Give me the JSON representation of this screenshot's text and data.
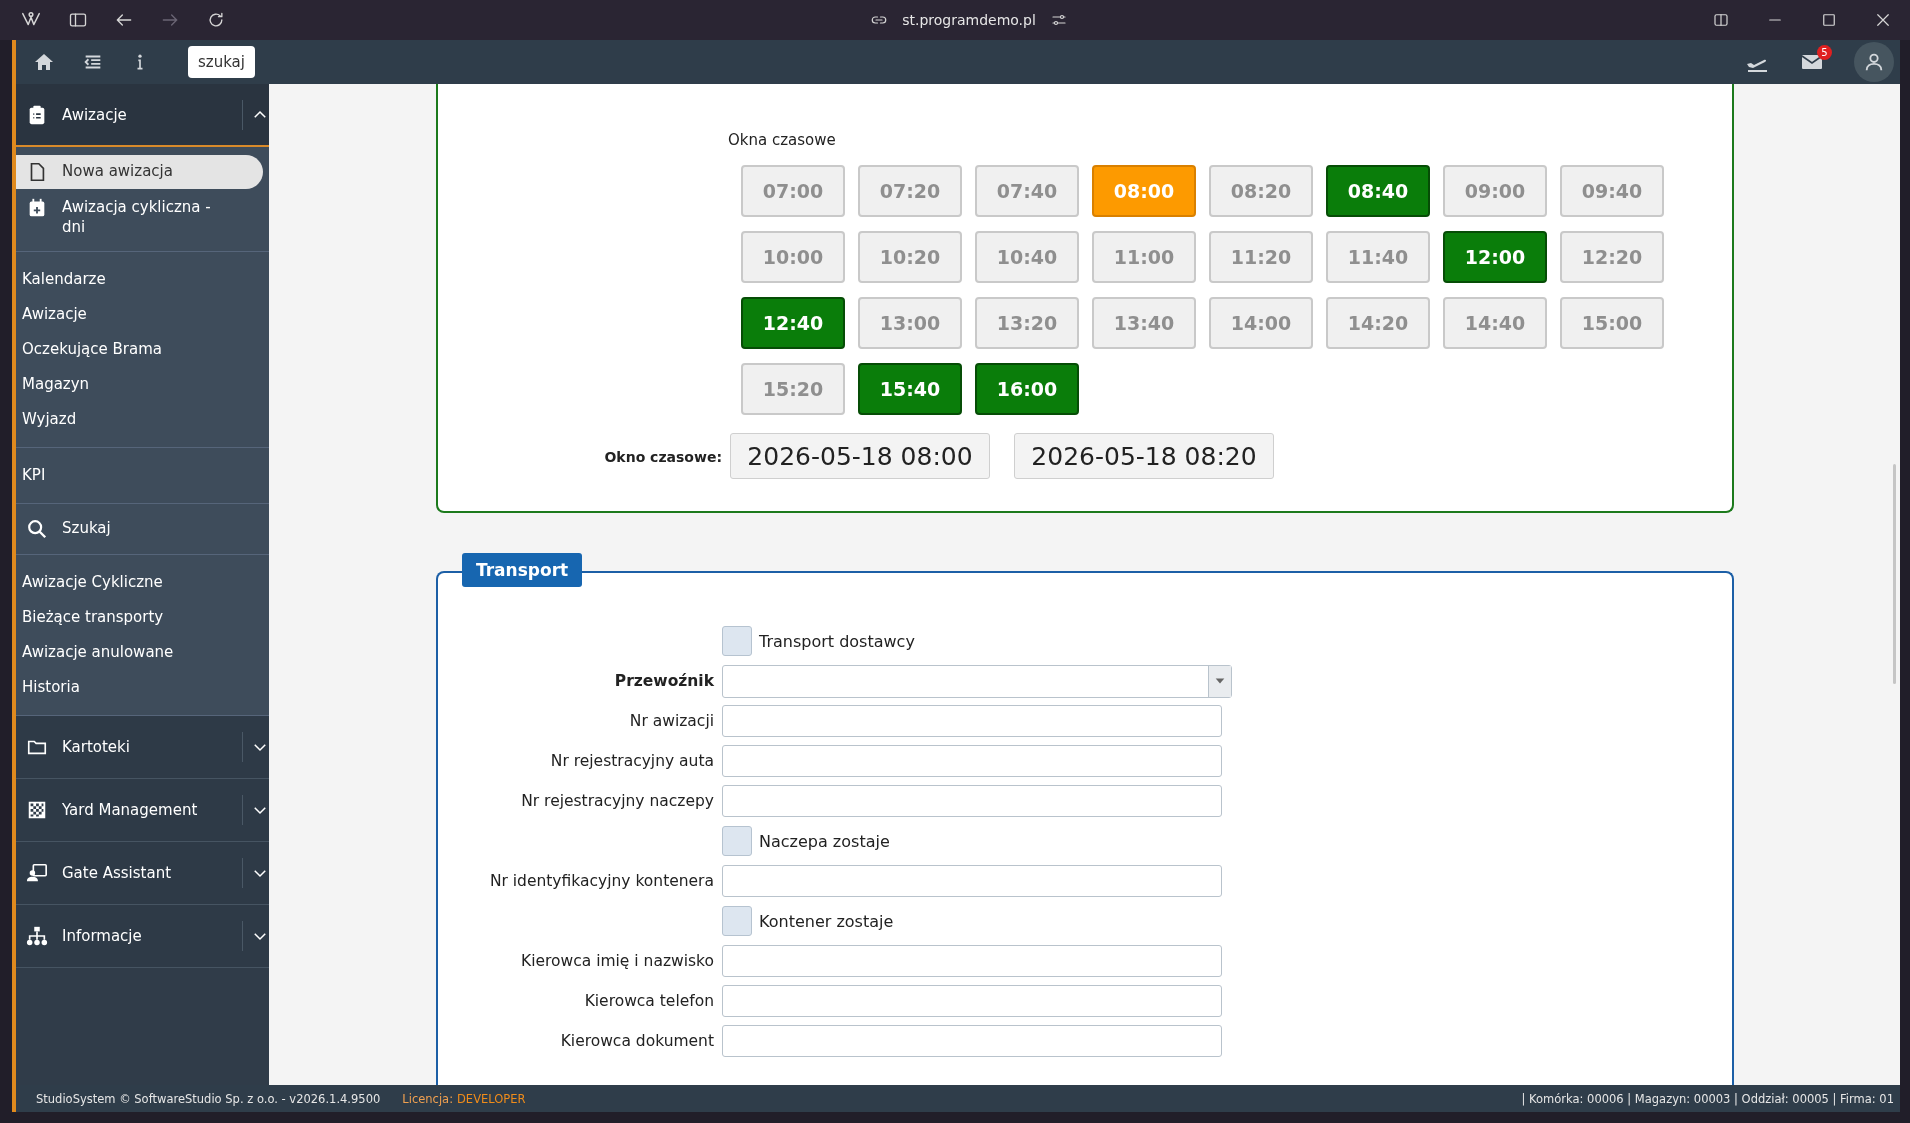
{
  "browser": {
    "url": "st.programdemo.pl",
    "forward_disabled": true
  },
  "toolbar": {
    "search_button": "szukaj",
    "mail_count": "5"
  },
  "sidebar": [
    {
      "kind": "header",
      "label": "Awizacje",
      "expanded": true
    },
    {
      "kind": "icon_links",
      "items": [
        {
          "label": "Nowa awizacja",
          "selected": true
        },
        {
          "label": "Awizacja cykliczna - dni",
          "selected": false
        }
      ]
    },
    {
      "kind": "links",
      "items": [
        "Kalendarze",
        "Awizacje",
        "Oczekujące Brama",
        "Magazyn",
        "Wyjazd"
      ]
    },
    {
      "kind": "links",
      "items": [
        "KPI"
      ]
    },
    {
      "kind": "icon_links",
      "items": [
        {
          "label": "Szukaj",
          "selected": false
        }
      ]
    },
    {
      "kind": "links",
      "items": [
        "Awizacje Cykliczne",
        "Bieżące transporty",
        "Awizacje anulowane",
        "Historia"
      ]
    },
    {
      "kind": "header",
      "label": "Kartoteki",
      "expanded": false
    },
    {
      "kind": "header",
      "label": "Yard Management",
      "expanded": false
    },
    {
      "kind": "header",
      "label": "Gate Assistant",
      "expanded": false
    },
    {
      "kind": "header",
      "label": "Informacje",
      "expanded": false
    }
  ],
  "time_windows": {
    "title": "Okna czasowe",
    "slots": [
      {
        "time": "07:00",
        "available": false,
        "selected": false
      },
      {
        "time": "07:20",
        "available": false,
        "selected": false
      },
      {
        "time": "07:40",
        "available": false,
        "selected": false
      },
      {
        "time": "08:00",
        "available": true,
        "selected": true
      },
      {
        "time": "08:20",
        "available": false,
        "selected": false
      },
      {
        "time": "08:40",
        "available": true,
        "selected": false
      },
      {
        "time": "09:00",
        "available": false,
        "selected": false
      },
      {
        "time": "09:40",
        "available": false,
        "selected": false
      },
      {
        "time": "10:00",
        "available": false,
        "selected": false
      },
      {
        "time": "10:20",
        "available": false,
        "selected": false
      },
      {
        "time": "10:40",
        "available": false,
        "selected": false
      },
      {
        "time": "11:00",
        "available": false,
        "selected": false
      },
      {
        "time": "11:20",
        "available": false,
        "selected": false
      },
      {
        "time": "11:40",
        "available": false,
        "selected": false
      },
      {
        "time": "12:00",
        "available": true,
        "selected": false
      },
      {
        "time": "12:20",
        "available": false,
        "selected": false
      },
      {
        "time": "12:40",
        "available": true,
        "selected": false
      },
      {
        "time": "13:00",
        "available": false,
        "selected": false
      },
      {
        "time": "13:20",
        "available": false,
        "selected": false
      },
      {
        "time": "13:40",
        "available": false,
        "selected": false
      },
      {
        "time": "14:00",
        "available": false,
        "selected": false
      },
      {
        "time": "14:20",
        "available": false,
        "selected": false
      },
      {
        "time": "14:40",
        "available": false,
        "selected": false
      },
      {
        "time": "15:00",
        "available": false,
        "selected": false
      },
      {
        "time": "15:20",
        "available": false,
        "selected": false
      },
      {
        "time": "15:40",
        "available": true,
        "selected": false
      },
      {
        "time": "16:00",
        "available": true,
        "selected": false
      }
    ],
    "range_label": "Okno czasowe:",
    "range": [
      "2026-05-18 08:00",
      "2026-05-18 08:20"
    ]
  },
  "transport": {
    "legend": "Transport",
    "rows": [
      {
        "kind": "checkbox",
        "label": "Transport dostawcy",
        "checked": false
      },
      {
        "kind": "select",
        "label": "Przewoźnik",
        "required": true
      },
      {
        "kind": "input",
        "label": "Nr awizacji",
        "required": false
      },
      {
        "kind": "input",
        "label": "Nr rejestracyjny auta",
        "required": false
      },
      {
        "kind": "input",
        "label": "Nr rejestracyjny naczepy",
        "required": false
      },
      {
        "kind": "checkbox",
        "label": "Naczepa zostaje",
        "checked": false
      },
      {
        "kind": "input",
        "label": "Nr identyfikacyjny kontenera",
        "required": false
      },
      {
        "kind": "checkbox",
        "label": "Kontener zostaje",
        "checked": false
      },
      {
        "kind": "input",
        "label": "Kierowca imię i nazwisko",
        "required": false
      },
      {
        "kind": "input",
        "label": "Kierowca telefon",
        "required": false
      },
      {
        "kind": "input",
        "label": "Kierowca dokument",
        "required": false
      }
    ]
  },
  "footer": {
    "copyright": "StudioSystem © SoftwareStudio Sp. z o.o. - v2026.1.4.9500",
    "license_label": "Licencja:",
    "license_value": "DEVELOPER",
    "context": "| Komórka: 00006 | Magazyn: 00003 | Oddział: 00005 | Firma: 01"
  }
}
